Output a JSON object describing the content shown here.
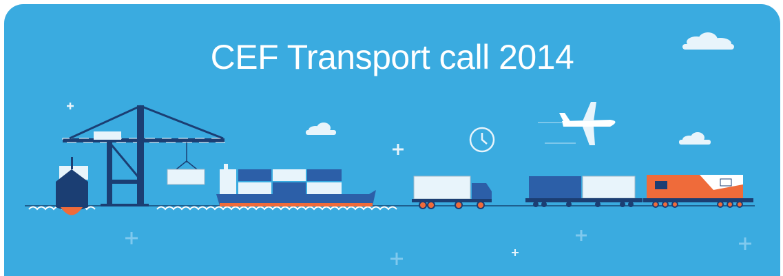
{
  "banner": {
    "title": "CEF Transport call 2014",
    "background_color": "#3aabe0"
  },
  "illustration": {
    "icons": [
      "cloud-icon",
      "plus-icon",
      "airplane-icon",
      "clock-icon",
      "crane-icon",
      "cargo-ship-icon",
      "container-ship-icon",
      "truck-icon",
      "freight-train-icon",
      "locomotive-icon",
      "waves-icon"
    ]
  }
}
